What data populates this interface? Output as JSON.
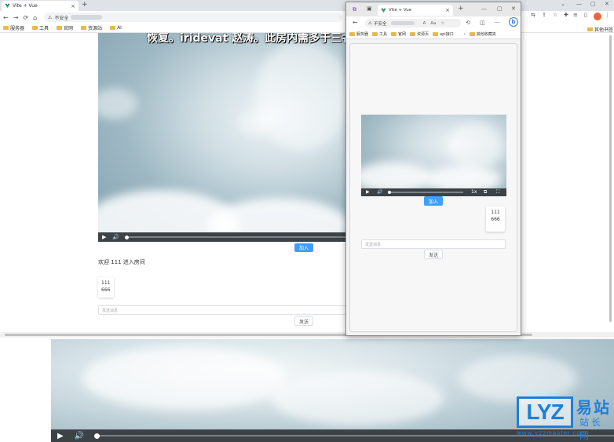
{
  "left_window": {
    "tab_title": "Vite + Vue",
    "new_tab": "+",
    "window_controls": [
      "⌄",
      "—",
      "▢",
      "✕"
    ],
    "nav": {
      "back": "←",
      "forward": "→",
      "reload": "⟳",
      "home": "⌂"
    },
    "address": {
      "security": "不安全"
    },
    "bookmarks": [
      "服务器",
      "工具",
      "官网",
      "资源站",
      "AI"
    ],
    "other_bookmarks": "其他书签",
    "subtitle": "恢复。iridevat 赵涛。此房内需多于三名记。",
    "join_button": "加入",
    "welcome_text": "欢迎 111 进入房间",
    "message_card": {
      "user": "111",
      "text": "666"
    },
    "message_input_placeholder": "发送消息",
    "send_button": "发送"
  },
  "right_window": {
    "tab_title": "Vite + Vue",
    "new_tab": "+",
    "window_controls": [
      "—",
      "▢",
      "✕"
    ],
    "address": {
      "security": "不安全"
    },
    "bookmarks": [
      "服务器",
      "工具",
      "官网",
      "资源页",
      "api接口"
    ],
    "other_bookmarks": "其他收藏夹",
    "video": {
      "speed": "1x"
    },
    "join_button": "加入",
    "message_card": {
      "user": "111",
      "text": "666"
    },
    "message_input_placeholder": "发送消息",
    "send_button": "发送"
  },
  "watermark": {
    "logo": "LYZ",
    "line1": "易站",
    "line2": "站长网",
    "url": "www.yzzmaster.com"
  }
}
